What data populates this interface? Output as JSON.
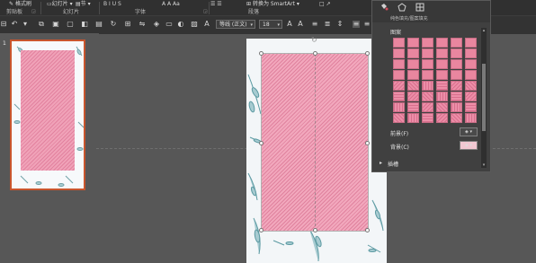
{
  "ribbon": {
    "clipboard_group": "剪贴板",
    "slides_group": "幻灯片",
    "font_group": "字体",
    "paragraph_group": "段落",
    "format_painter": "格式刷",
    "new_slide": "幻灯片",
    "section_label": "节",
    "smartart_label": "转换为 SmartArt"
  },
  "toolbar": {
    "font_name": "等线 (正文)",
    "font_size": "18"
  },
  "thumbnails": [
    {
      "number": "1"
    }
  ],
  "format_panel": {
    "title": "纯色填充/图案填充",
    "pattern_label": "图案",
    "foreground_label": "前景(F)",
    "background_label": "背景(C)",
    "insert_label": "插槽",
    "fill_color": "#e9869f",
    "pattern_count": 48
  }
}
